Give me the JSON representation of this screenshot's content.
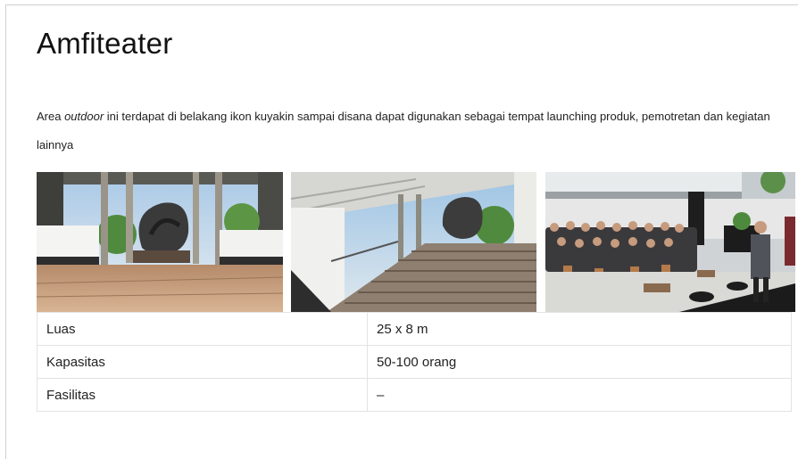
{
  "page": {
    "title": "Amfiteater",
    "description": {
      "before": "Area ",
      "emphasis": "outdoor",
      "after": " ini terdapat di belakang ikon kuyakin sampai disana dapat digunakan sebagai tempat launching produk, pemotretan dan kegiatan lainnya"
    }
  },
  "gallery": [
    {
      "name": "amphitheater-sculpture-photo"
    },
    {
      "name": "amphitheater-steps-photo"
    },
    {
      "name": "amphitheater-event-photo"
    }
  ],
  "specs": [
    {
      "label": "Luas",
      "value": "25 x 8 m"
    },
    {
      "label": "Kapasitas",
      "value": "50-100 orang"
    },
    {
      "label": "Fasilitas",
      "value": "–"
    }
  ],
  "colors": {
    "border": "#cfcfcf",
    "table_border": "#e3e3e3",
    "text": "#1a1a1a"
  }
}
